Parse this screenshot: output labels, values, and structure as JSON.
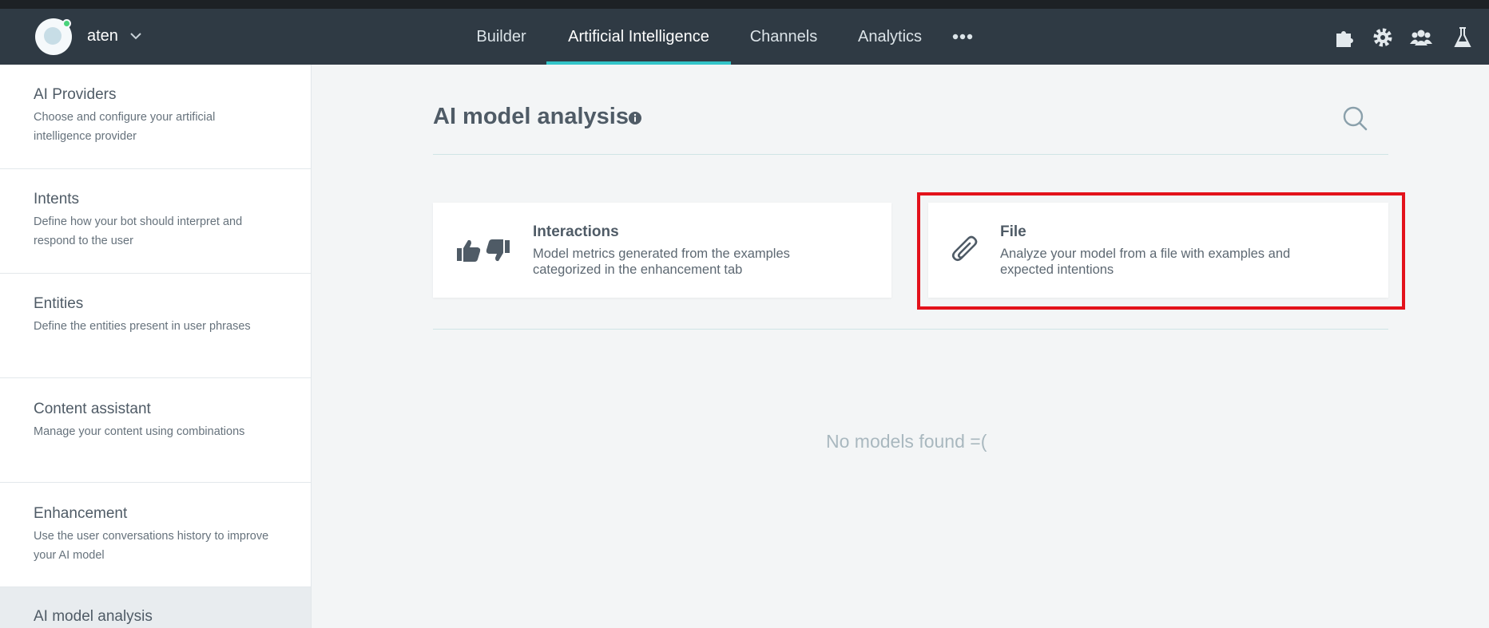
{
  "header": {
    "bot_name": "aten",
    "tabs": [
      {
        "label": "Builder",
        "active": false
      },
      {
        "label": "Artificial Intelligence",
        "active": true
      },
      {
        "label": "Channels",
        "active": false
      },
      {
        "label": "Analytics",
        "active": false
      }
    ],
    "more_icon": "more-dots-icon",
    "icons": [
      "puzzle-icon",
      "gear-icon",
      "team-icon",
      "flask-icon"
    ]
  },
  "sidebar": {
    "items": [
      {
        "title": "AI Providers",
        "description": "Choose and configure your artificial intelligence provider"
      },
      {
        "title": "Intents",
        "description": "Define how your bot should interpret and respond to the user"
      },
      {
        "title": "Entities",
        "description": "Define the entities present in user phrases"
      },
      {
        "title": "Content assistant",
        "description": "Manage your content using combinations"
      },
      {
        "title": "Enhancement",
        "description": "Use the user conversations history to improve your AI model"
      },
      {
        "title": "AI model analysis",
        "description": ""
      }
    ],
    "active_item": "AI model analysis"
  },
  "main": {
    "title": "AI model analysis",
    "cards": [
      {
        "title": "Interactions",
        "description": "Model metrics generated from the examples categorized in the enhancement tab",
        "icon": "thumbs-up-down-icon"
      },
      {
        "title": "File",
        "description": "Analyze your model from a file with examples and expected intentions",
        "icon": "paperclip-icon"
      }
    ],
    "empty_state": "No models found =("
  },
  "colors": {
    "navbar": "#2f3a44",
    "accent": "#32c4c8",
    "highlight": "#e3121b",
    "background": "#f3f5f6"
  }
}
